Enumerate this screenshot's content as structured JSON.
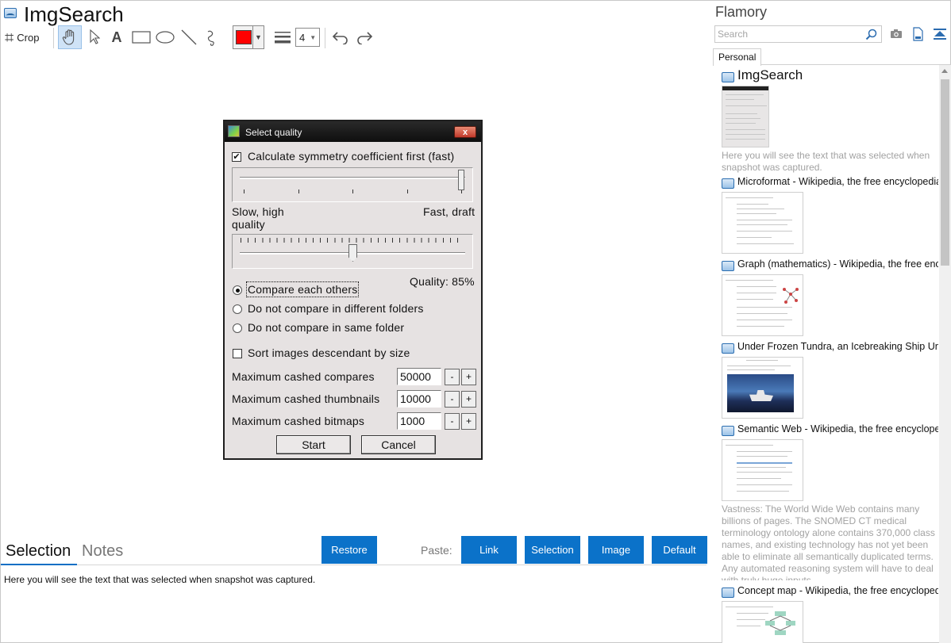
{
  "app": {
    "title": "ImgSearch"
  },
  "toolbar": {
    "crop_label": "Crop",
    "line_width": "4",
    "color": "#ff0000"
  },
  "dialog": {
    "title": "Select quality",
    "close_label": "x",
    "symmetry_checkbox": {
      "label": "Calculate symmetry coefficient first (fast)",
      "checked": true
    },
    "speed_slider": {
      "left_label": "Slow, high quality",
      "right_label": "Fast, draft",
      "value_fraction": 1.0
    },
    "quality_slider": {
      "label": "Quality: 85%",
      "value_fraction": 0.5
    },
    "compare_options": [
      {
        "label": "Compare each others",
        "selected": true
      },
      {
        "label": "Do not compare in different folders",
        "selected": false
      },
      {
        "label": "Do not compare in same folder",
        "selected": false
      }
    ],
    "sort_checkbox": {
      "label": "Sort images descendant by size",
      "checked": false
    },
    "fields": [
      {
        "label": "Maximum cashed compares",
        "value": "50000"
      },
      {
        "label": "Maximum cashed thumbnails",
        "value": "10000"
      },
      {
        "label": "Maximum cashed bitmaps",
        "value": "1000"
      }
    ],
    "minus": "-",
    "plus": "+",
    "start_label": "Start",
    "cancel_label": "Cancel"
  },
  "bottom": {
    "tabs": [
      "Selection",
      "Notes"
    ],
    "restore_label": "Restore",
    "paste_label": "Paste:",
    "paste_buttons": [
      "Link",
      "Selection",
      "Image",
      "Default"
    ],
    "selection_text": "Here you will see the text that was selected when snapshot was captured."
  },
  "sidebar": {
    "title": "Flamory",
    "search_placeholder": "Search",
    "tab": "Personal",
    "items": [
      {
        "title": "ImgSearch",
        "desc": "Here you will see the text that was selected when snapshot was captured."
      },
      {
        "title": "Microformat - Wikipedia, the free encyclopedia",
        "desc": ""
      },
      {
        "title": "Graph (mathematics) - Wikipedia, the free encyc",
        "desc": ""
      },
      {
        "title": "Under Frozen Tundra, an Icebreaking Ship Unco",
        "desc": ""
      },
      {
        "title": "Semantic Web - Wikipedia, the free encycloped",
        "desc": "Vastness: The World Wide Web contains many billions of pages. The SNOMED CT medical terminology ontology alone contains 370,000 class names, and existing technology has not yet been able to eliminate all semantically duplicated terms. Any automated reasoning system will have to deal with truly huge inputs."
      },
      {
        "title": "Concept map - Wikipedia, the free encyclopedi",
        "desc": ""
      }
    ]
  }
}
